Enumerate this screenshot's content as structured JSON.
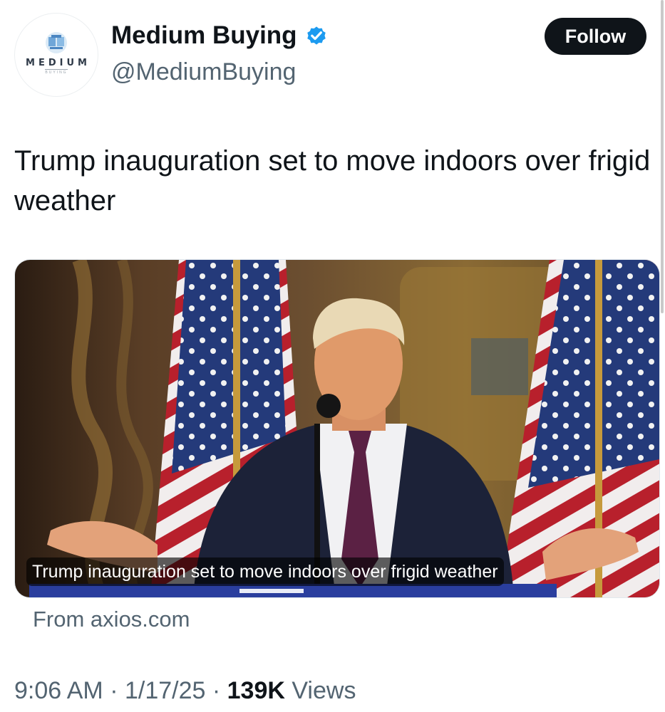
{
  "account": {
    "display_name": "Medium Buying",
    "handle": "@MediumBuying",
    "verified": true,
    "verified_icon": "verified-badge-icon",
    "avatar_brand": "MEDIUM",
    "avatar_sub": "BUYING"
  },
  "follow_button": {
    "label": "Follow"
  },
  "tweet": {
    "text": "Trump inauguration set to move indoors over frigid weather"
  },
  "link_card": {
    "caption": "Trump inauguration set to move indoors over frigid weather",
    "source": "From axios.com"
  },
  "meta": {
    "time": "9:06 AM",
    "sep1": " · ",
    "date": "1/17/25",
    "sep2": " · ",
    "views_count": "139K",
    "views_label": " Views"
  },
  "colors": {
    "text_primary": "#0f1419",
    "text_secondary": "#536471",
    "verified_blue": "#1d9bf0",
    "follow_bg": "#0f1419"
  }
}
